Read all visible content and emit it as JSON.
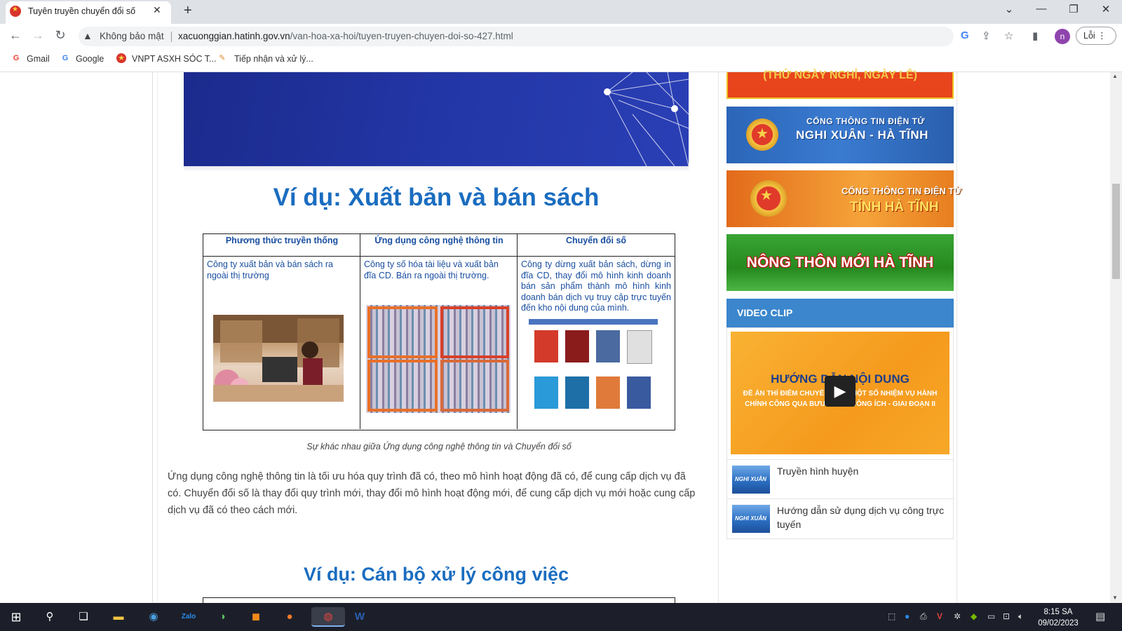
{
  "browser": {
    "tab_title": "Tuyên truyền chuyển đổi số",
    "tab_close": "✕",
    "new_tab": "+",
    "security_label": "Không bảo mật",
    "url_domain": "xacuonggian.hatinh.gov.vn",
    "url_path": "/van-hoa-xa-hoi/tuyen-truyen-chuyen-doi-so-427.html",
    "profile_initial": "n",
    "error_button": "Lỗi",
    "bookmarks": [
      {
        "label": "Gmail"
      },
      {
        "label": "Google"
      },
      {
        "label": "VNPT ASXH SÓC T..."
      },
      {
        "label": "Tiếp nhận và xử lý..."
      }
    ]
  },
  "article": {
    "slide1_title": "Ví dụ: Xuất bản và bán sách",
    "comparison": {
      "headers": [
        "Phương thức truyền thống",
        "Ứng dụng công nghệ thông tin",
        "Chuyển đổi số"
      ],
      "cells": [
        "Công ty xuất bản và bán sách ra ngoài thị trường",
        "Công ty số hóa tài liệu và xuất bản đĩa CD. Bán ra ngoài thị trường.",
        "Công ty dừng xuất bản sách, dừng in đĩa CD, thay đổi mô hình kinh doanh bán sản phẩm thành mô hình kinh doanh bán dịch vụ truy cập trực tuyến đến kho nội dung của mình."
      ]
    },
    "caption": "Sự khác nhau giữa Ứng dụng công nghệ thông tin và Chuyển đổi số",
    "paragraph": "Ứng dụng công nghệ thông tin là tối ưu hóa quy trình đã có, theo mô hình hoạt động đã có, để cung cấp dịch vụ đã có. Chuyển đổi số là thay đổi quy trình mới, thay đổi mô hình hoạt động mới, để cung cấp dịch vụ mới hoặc cung cấp dịch vụ đã có theo cách mới.",
    "slide2_title": "Ví dụ: Cán bộ xử lý công việc"
  },
  "sidebar": {
    "banner0_text": "(THỨ NGÀY NGHỈ, NGÀY LỄ)",
    "banner1_line1": "CỔNG THÔNG TIN ĐIỆN TỬ",
    "banner1_line2": "NGHI XUÂN - HÀ TĨNH",
    "banner2_line1": "CỔNG THÔNG TIN ĐIỆN TỬ",
    "banner2_line2": "TỈNH HÀ TĨNH",
    "banner3_text": "NÔNG THÔN MỚI HÀ TĨNH",
    "video_heading": "VIDEO CLIP",
    "video_thumb_title": "HƯỚNG DẪN NỘI DUNG",
    "video_thumb_sub": "ĐỀ ÁN THÍ ĐIỂM CHUYỂN GIAO MỘT SỐ NHIỆM VỤ HÀNH CHÍNH CÔNG QUA BƯU CHÍNH CÔNG ÍCH - GIAI ĐOẠN II",
    "video_items": [
      {
        "title": "Truyền hình huyện",
        "thumb_label": "NGHI XUÂN"
      },
      {
        "title": "Hướng dẫn sử dụng dịch vụ công trực tuyến",
        "thumb_label": "NGHI XUÂN"
      }
    ]
  },
  "taskbar": {
    "time": "8:15 SA",
    "date": "09/02/2023"
  },
  "colors": {
    "heading_blue": "#1a6dc0",
    "video_header": "#3b86cc",
    "taskbar": "#1c1f2a"
  }
}
